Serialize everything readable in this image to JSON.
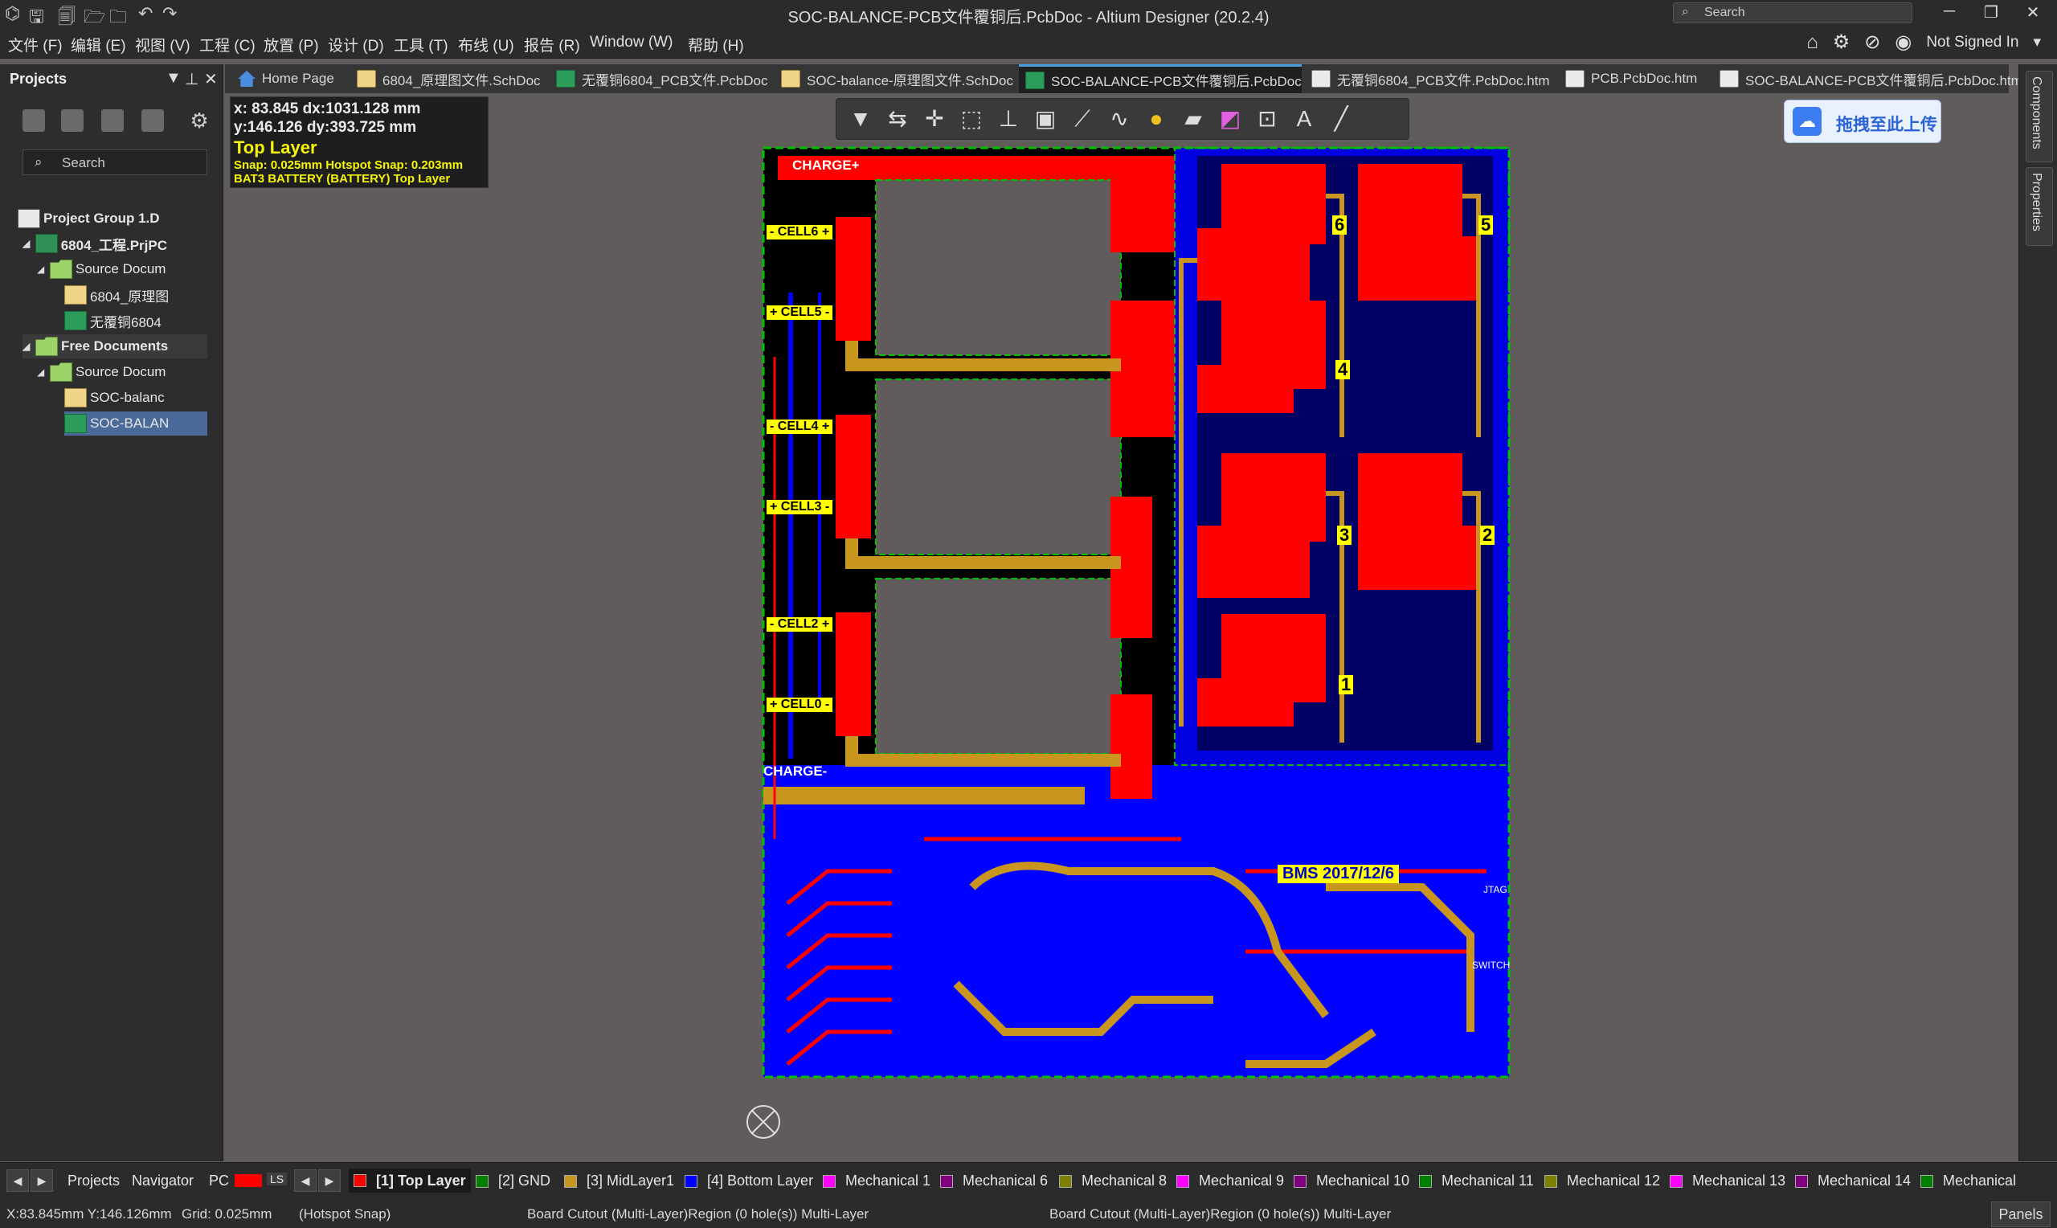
{
  "window": {
    "title": "SOC-BALANCE-PCB文件覆铜后.PcbDoc - Altium Designer (20.2.4)",
    "search_placeholder": "Search"
  },
  "menu": {
    "items": [
      "文件 (F)",
      "编辑 (E)",
      "视图 (V)",
      "工程 (C)",
      "放置 (P)",
      "设计 (D)",
      "工具 (T)",
      "布线 (U)",
      "报告 (R)",
      "Window (W)",
      "帮助 (H)"
    ],
    "account": "Not Signed In"
  },
  "tabs": [
    {
      "label": "Home Page",
      "kind": "home"
    },
    {
      "label": "6804_原理图文件.SchDoc",
      "kind": "sch"
    },
    {
      "label": "无覆铜6804_PCB文件.PcbDoc",
      "kind": "pcb"
    },
    {
      "label": "SOC-balance-原理图文件.SchDoc",
      "kind": "sch"
    },
    {
      "label": "SOC-BALANCE-PCB文件覆铜后.PcbDoc",
      "kind": "pcb",
      "active": true
    },
    {
      "label": "无覆铜6804_PCB文件.PcbDoc.htm",
      "kind": "doc"
    },
    {
      "label": "PCB.PcbDoc.htm",
      "kind": "doc"
    },
    {
      "label": "SOC-BALANCE-PCB文件覆铜后.PcbDoc.htm",
      "kind": "doc"
    }
  ],
  "projects_panel": {
    "title": "Projects",
    "search_placeholder": "Search",
    "tree": [
      {
        "label": "Project Group 1.D",
        "icon": "group",
        "bold": true
      },
      {
        "label": "6804_工程.PrjPC",
        "icon": "project",
        "bold": true
      },
      {
        "label": "Source Docum",
        "icon": "folder"
      },
      {
        "label": "6804_原理图",
        "icon": "sch"
      },
      {
        "label": "无覆铜6804",
        "icon": "pcb"
      },
      {
        "label": "Free Documents",
        "icon": "folder",
        "bold": true
      },
      {
        "label": "Source Docum",
        "icon": "folder"
      },
      {
        "label": "SOC-balanc",
        "icon": "sch"
      },
      {
        "label": "SOC-BALAN",
        "icon": "pcb",
        "selected": true
      }
    ]
  },
  "hud": {
    "line1": "x: 83.845    dx:1031.128 mm",
    "line2": "y:146.126    dy:393.725   mm",
    "layer": "Top Layer",
    "snap": "Snap: 0.025mm Hotspot Snap: 0.203mm",
    "component": "BAT3 BATTERY (BATTERY) Top Layer"
  },
  "upload_button": "拖拽至此上传",
  "pcb": {
    "charge_plus": "CHARGE+",
    "charge_minus": "CHARGE-",
    "cells": [
      "- CELL6 +",
      "+ CELL5 -",
      "- CELL4 +",
      "+ CELL3 -",
      "- CELL2 +",
      "+ CELL0 -"
    ],
    "section_numbers": [
      "6",
      "5",
      "4",
      "3",
      "2",
      "1"
    ],
    "date_label": "BMS 2017/12/6",
    "jtag": "JTAG",
    "switch": "SWITCH",
    "colors": {
      "top_copper": "#ff0000",
      "bottom_copper": "#0000ff",
      "mid_layer": "#c8961e",
      "outline": "#00c000",
      "board_bg": "#000000"
    }
  },
  "right_panels": [
    "Components",
    "Properties"
  ],
  "layer_bar": {
    "left_tabs": [
      "Projects",
      "Navigator",
      "PC"
    ],
    "ls": "LS",
    "layers": [
      {
        "label": "[1] Top Layer",
        "color": "#ff0000",
        "active": true
      },
      {
        "label": "[2] GND",
        "color": "#008000"
      },
      {
        "label": "[3] MidLayer1",
        "color": "#c8961e"
      },
      {
        "label": "[4] Bottom Layer",
        "color": "#0000ff"
      },
      {
        "label": "Mechanical 1",
        "color": "#ff00ff"
      },
      {
        "label": "Mechanical 6",
        "color": "#800080"
      },
      {
        "label": "Mechanical 8",
        "color": "#808000"
      },
      {
        "label": "Mechanical 9",
        "color": "#ff00ff"
      },
      {
        "label": "Mechanical 10",
        "color": "#800080"
      },
      {
        "label": "Mechanical 11",
        "color": "#008000"
      },
      {
        "label": "Mechanical 12",
        "color": "#808000"
      },
      {
        "label": "Mechanical 13",
        "color": "#ff00ff"
      },
      {
        "label": "Mechanical 14",
        "color": "#800080"
      },
      {
        "label": "Mechanical",
        "color": "#008000"
      }
    ]
  },
  "status_bar": {
    "coords": "X:83.845mm Y:146.126mm",
    "grid": "Grid: 0.025mm",
    "snap": "(Hotspot Snap)",
    "object1": "Board Cutout (Multi-Layer)Region (0 hole(s)) Multi-Layer",
    "object2": "Board Cutout (Multi-Layer)Region (0 hole(s)) Multi-Layer",
    "panels": "Panels"
  }
}
